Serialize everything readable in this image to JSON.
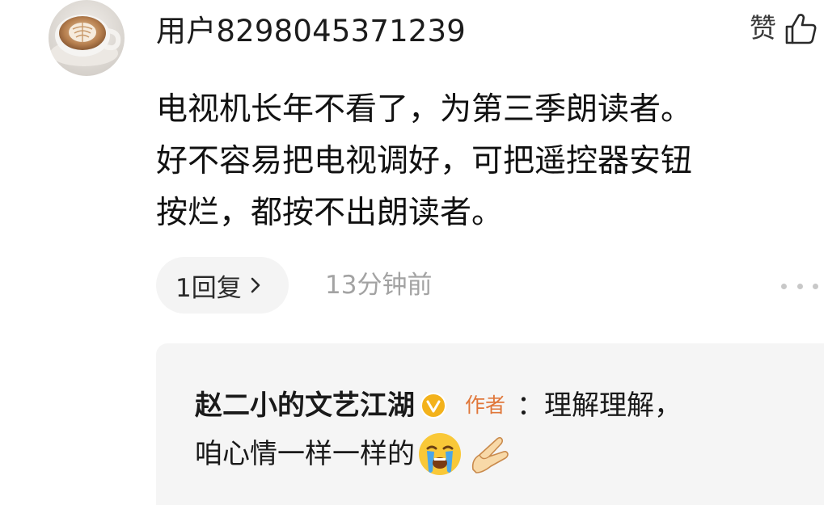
{
  "comment": {
    "username": "用户8298045371239",
    "like_label": "赞",
    "content": "电视机长年不看了，为第三季朗读者。\n好不容易把电视调好，可把遥控器安钮\n按烂，都按不出朗读者。",
    "reply_count_label": "1回复",
    "timestamp": "13分钟前"
  },
  "reply": {
    "author": "赵二小的文艺江湖",
    "author_tag": "作者",
    "text_line1": "：理解理解，",
    "text_line2": "咱心情一样一样的",
    "emojis": [
      "loudly-crying-face-emoji",
      "pinched-fingers-hand-emoji"
    ]
  },
  "icons": {
    "like": "thumbs-up-icon",
    "reply_chevron": "chevron-right-icon",
    "more": "more-dots-icon",
    "verified": "verified-v-badge-icon"
  },
  "colors": {
    "author_tag": "#e0773a",
    "verified_badge": "#f3b21b",
    "timestamp": "#a3a3a3",
    "reply_bg": "#f5f5f5",
    "pill_bg": "#f4f4f4"
  }
}
